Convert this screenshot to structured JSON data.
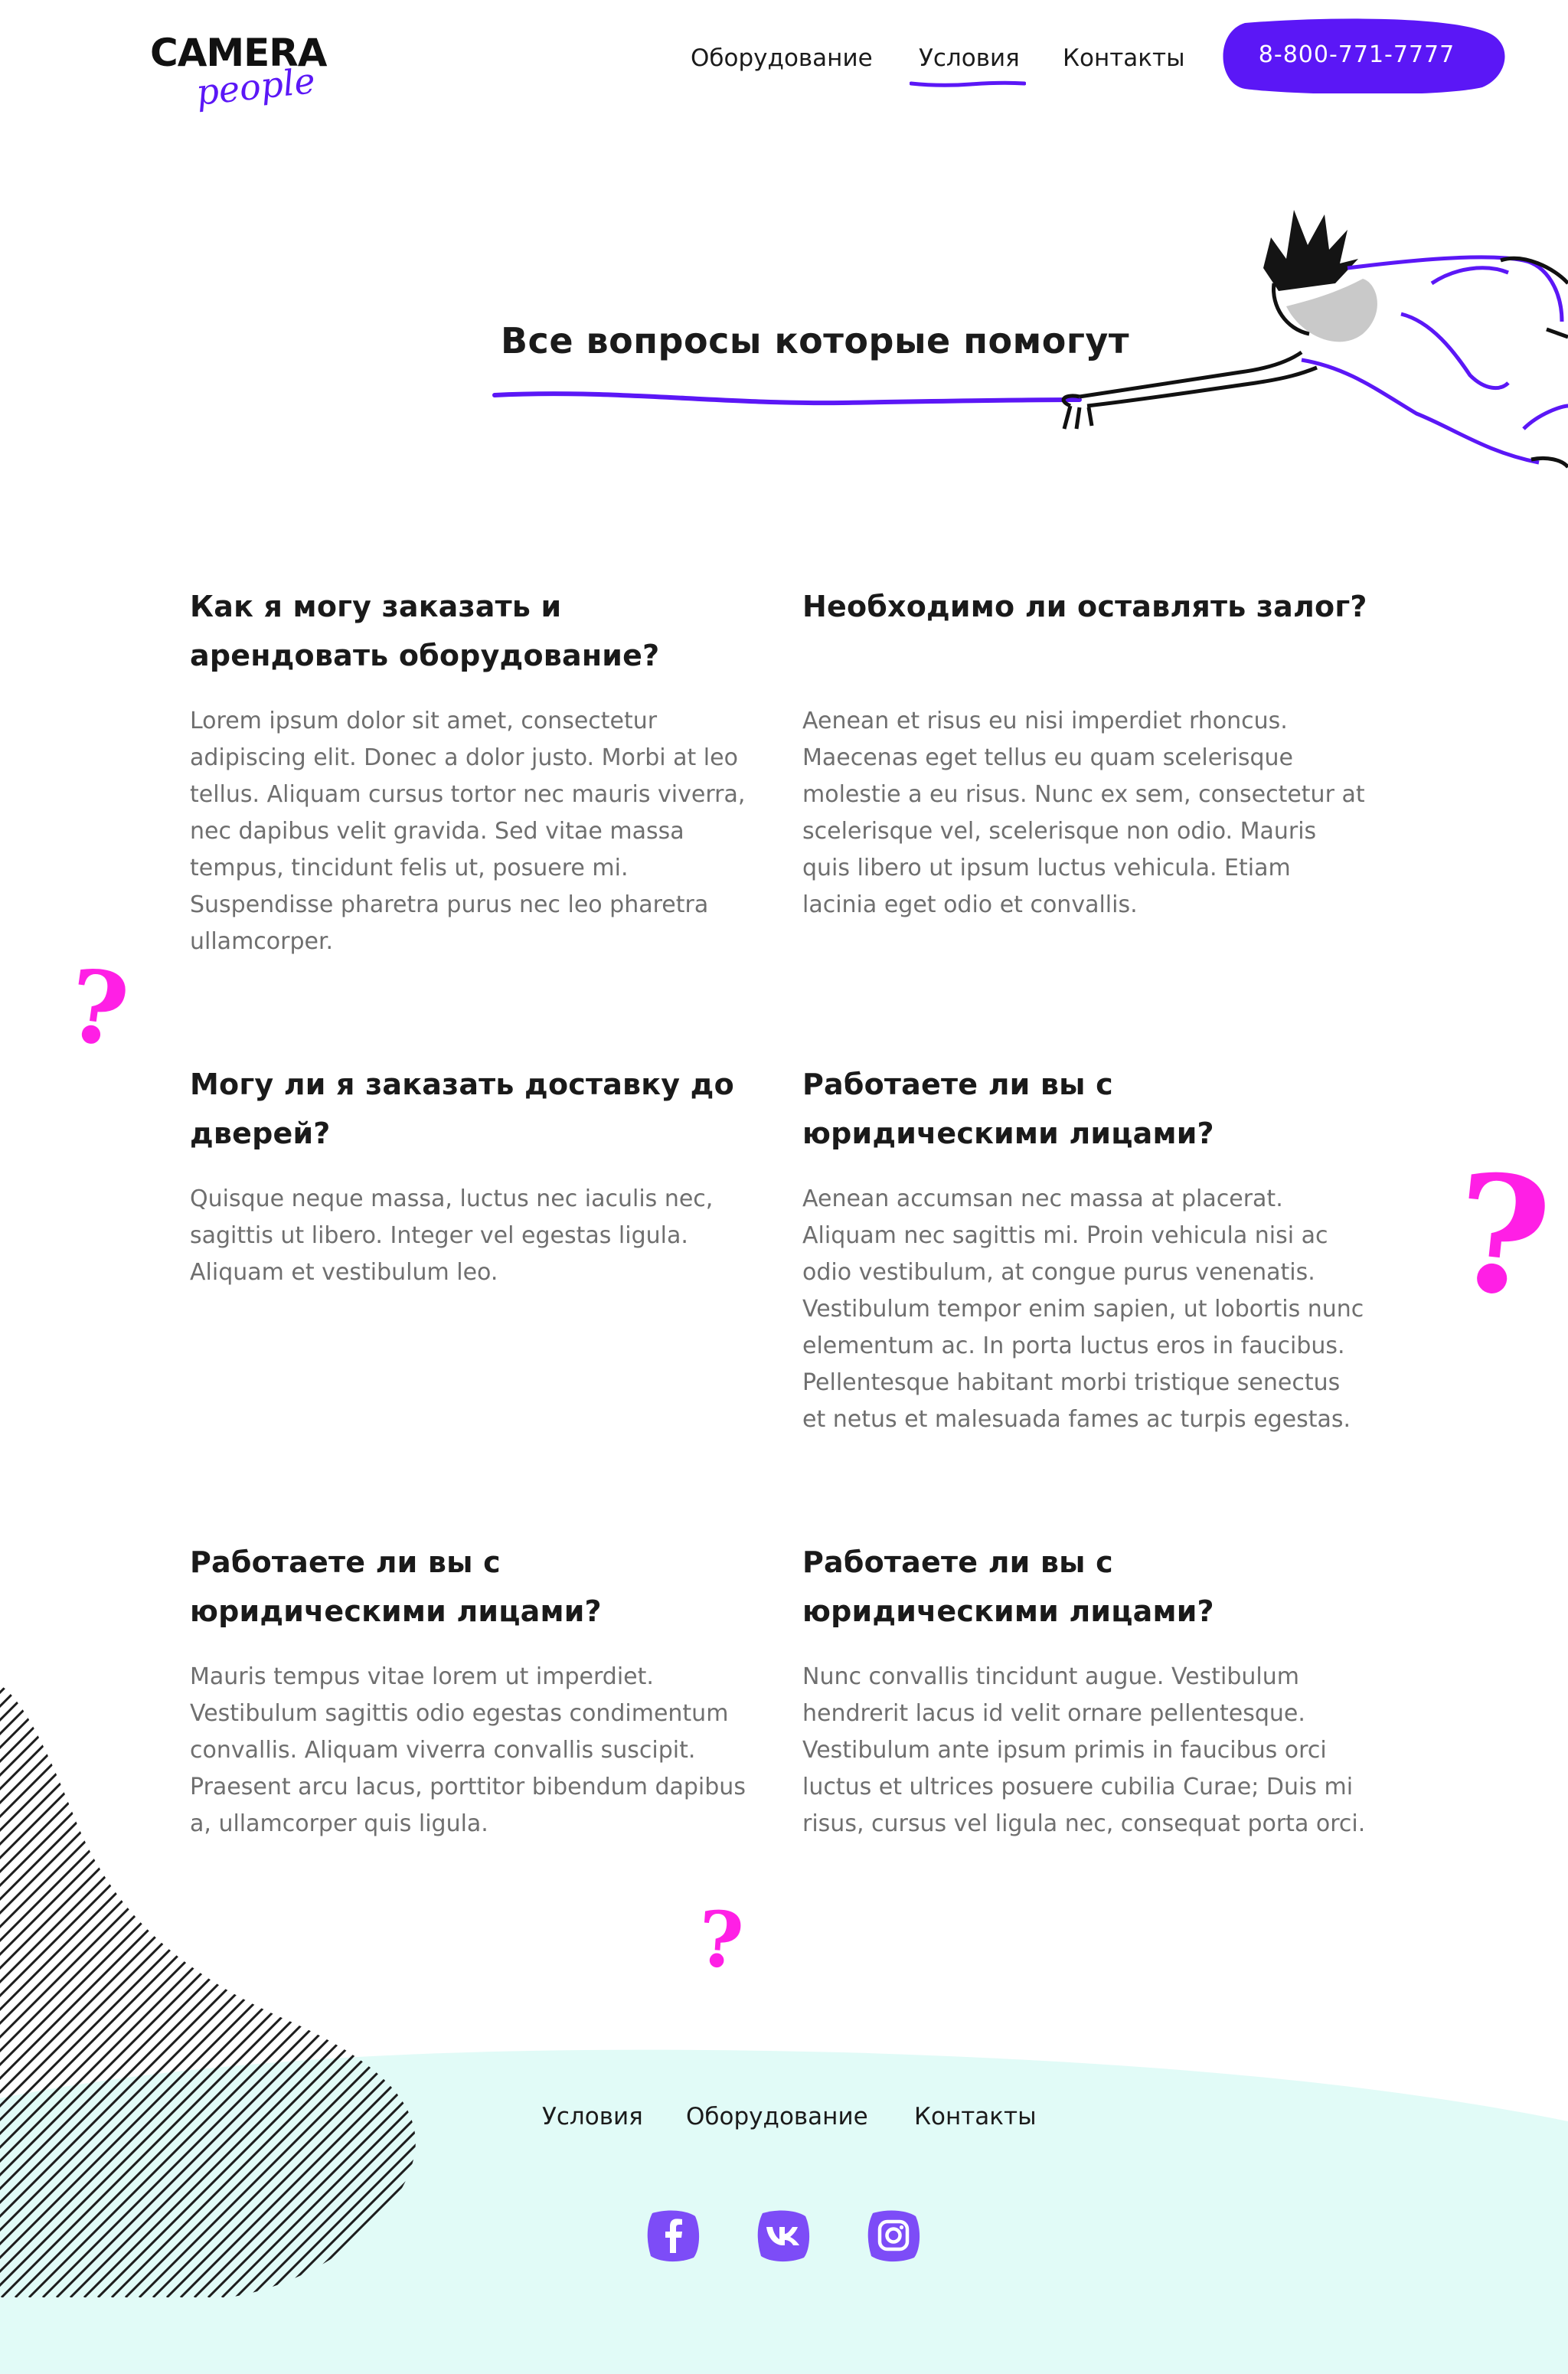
{
  "header": {
    "logo_main": "CAMERA",
    "logo_sub": "people",
    "nav": [
      "Оборудование",
      "Условия",
      "Контакты"
    ],
    "active_nav": "Условия",
    "phone": "8-800-771-7777"
  },
  "hero": {
    "title": "Все вопросы которые помогут"
  },
  "faq": [
    {
      "q": "Как я могу заказать и арендовать оборудование?",
      "a": "Lorem ipsum dolor sit amet, consectetur adipiscing elit. Donec a dolor justo. Morbi at leo tellus. Aliquam cursus tortor nec mauris viverra, nec dapibus velit gravida. Sed vitae massa tempus, tincidunt felis ut, posuere mi. Suspendisse pharetra purus nec leo pharetra ullamcorper."
    },
    {
      "q": "Необходимо ли оставлять залог?",
      "a": "Aenean et risus eu nisi imperdiet rhoncus. Maecenas eget tellus eu quam scelerisque molestie a eu risus. Nunc ex sem, consectetur at scelerisque vel, scelerisque non odio. Mauris quis libero ut ipsum luctus vehicula. Etiam lacinia eget odio et convallis."
    },
    {
      "q": "Могу ли я заказать доставку до дверей?",
      "a": "Quisque neque massa, luctus nec iaculis nec, sagittis ut libero. Integer vel egestas ligula. Aliquam et vestibulum leo."
    },
    {
      "q": "Работаете ли вы с юридическими лицами?",
      "a": "Aenean accumsan nec massa at placerat. Aliquam nec sagittis mi. Proin vehicula nisi ac odio vestibulum, at congue purus venenatis. Vestibulum tempor enim sapien, ut lobortis nunc elementum ac. In porta luctus eros in faucibus. Pellentesque habitant morbi tristique senectus et netus et malesuada fames ac turpis egestas."
    },
    {
      "q": "Работаете ли вы с юридическими лицами?",
      "a": "Mauris tempus vitae lorem ut imperdiet. Vestibulum sagittis odio egestas condimentum convallis. Aliquam viverra convallis suscipit. Praesent arcu lacus, porttitor bibendum dapibus a, ullamcorper quis ligula."
    },
    {
      "q": "Работаете ли вы с юридическими лицами?",
      "a": "Nunc convallis tincidunt augue. Vestibulum hendrerit lacus id velit ornare pellentesque. Vestibulum ante ipsum primis in faucibus orci luctus et ultrices posuere cubilia Curae; Duis mi risus, cursus vel ligula nec, consequat porta orci."
    }
  ],
  "decorations": {
    "question_mark": "?"
  },
  "footer": {
    "nav": [
      "Условия",
      "Оборудование",
      "Контакты"
    ],
    "social": [
      "facebook-icon",
      "vk-icon",
      "instagram-icon"
    ]
  },
  "colors": {
    "accent": "#5b17f6",
    "magenta": "#ff1fe5",
    "footer_bg": "#e1fbf7",
    "text": "#1b1b1b",
    "muted": "#6f6f6f"
  }
}
